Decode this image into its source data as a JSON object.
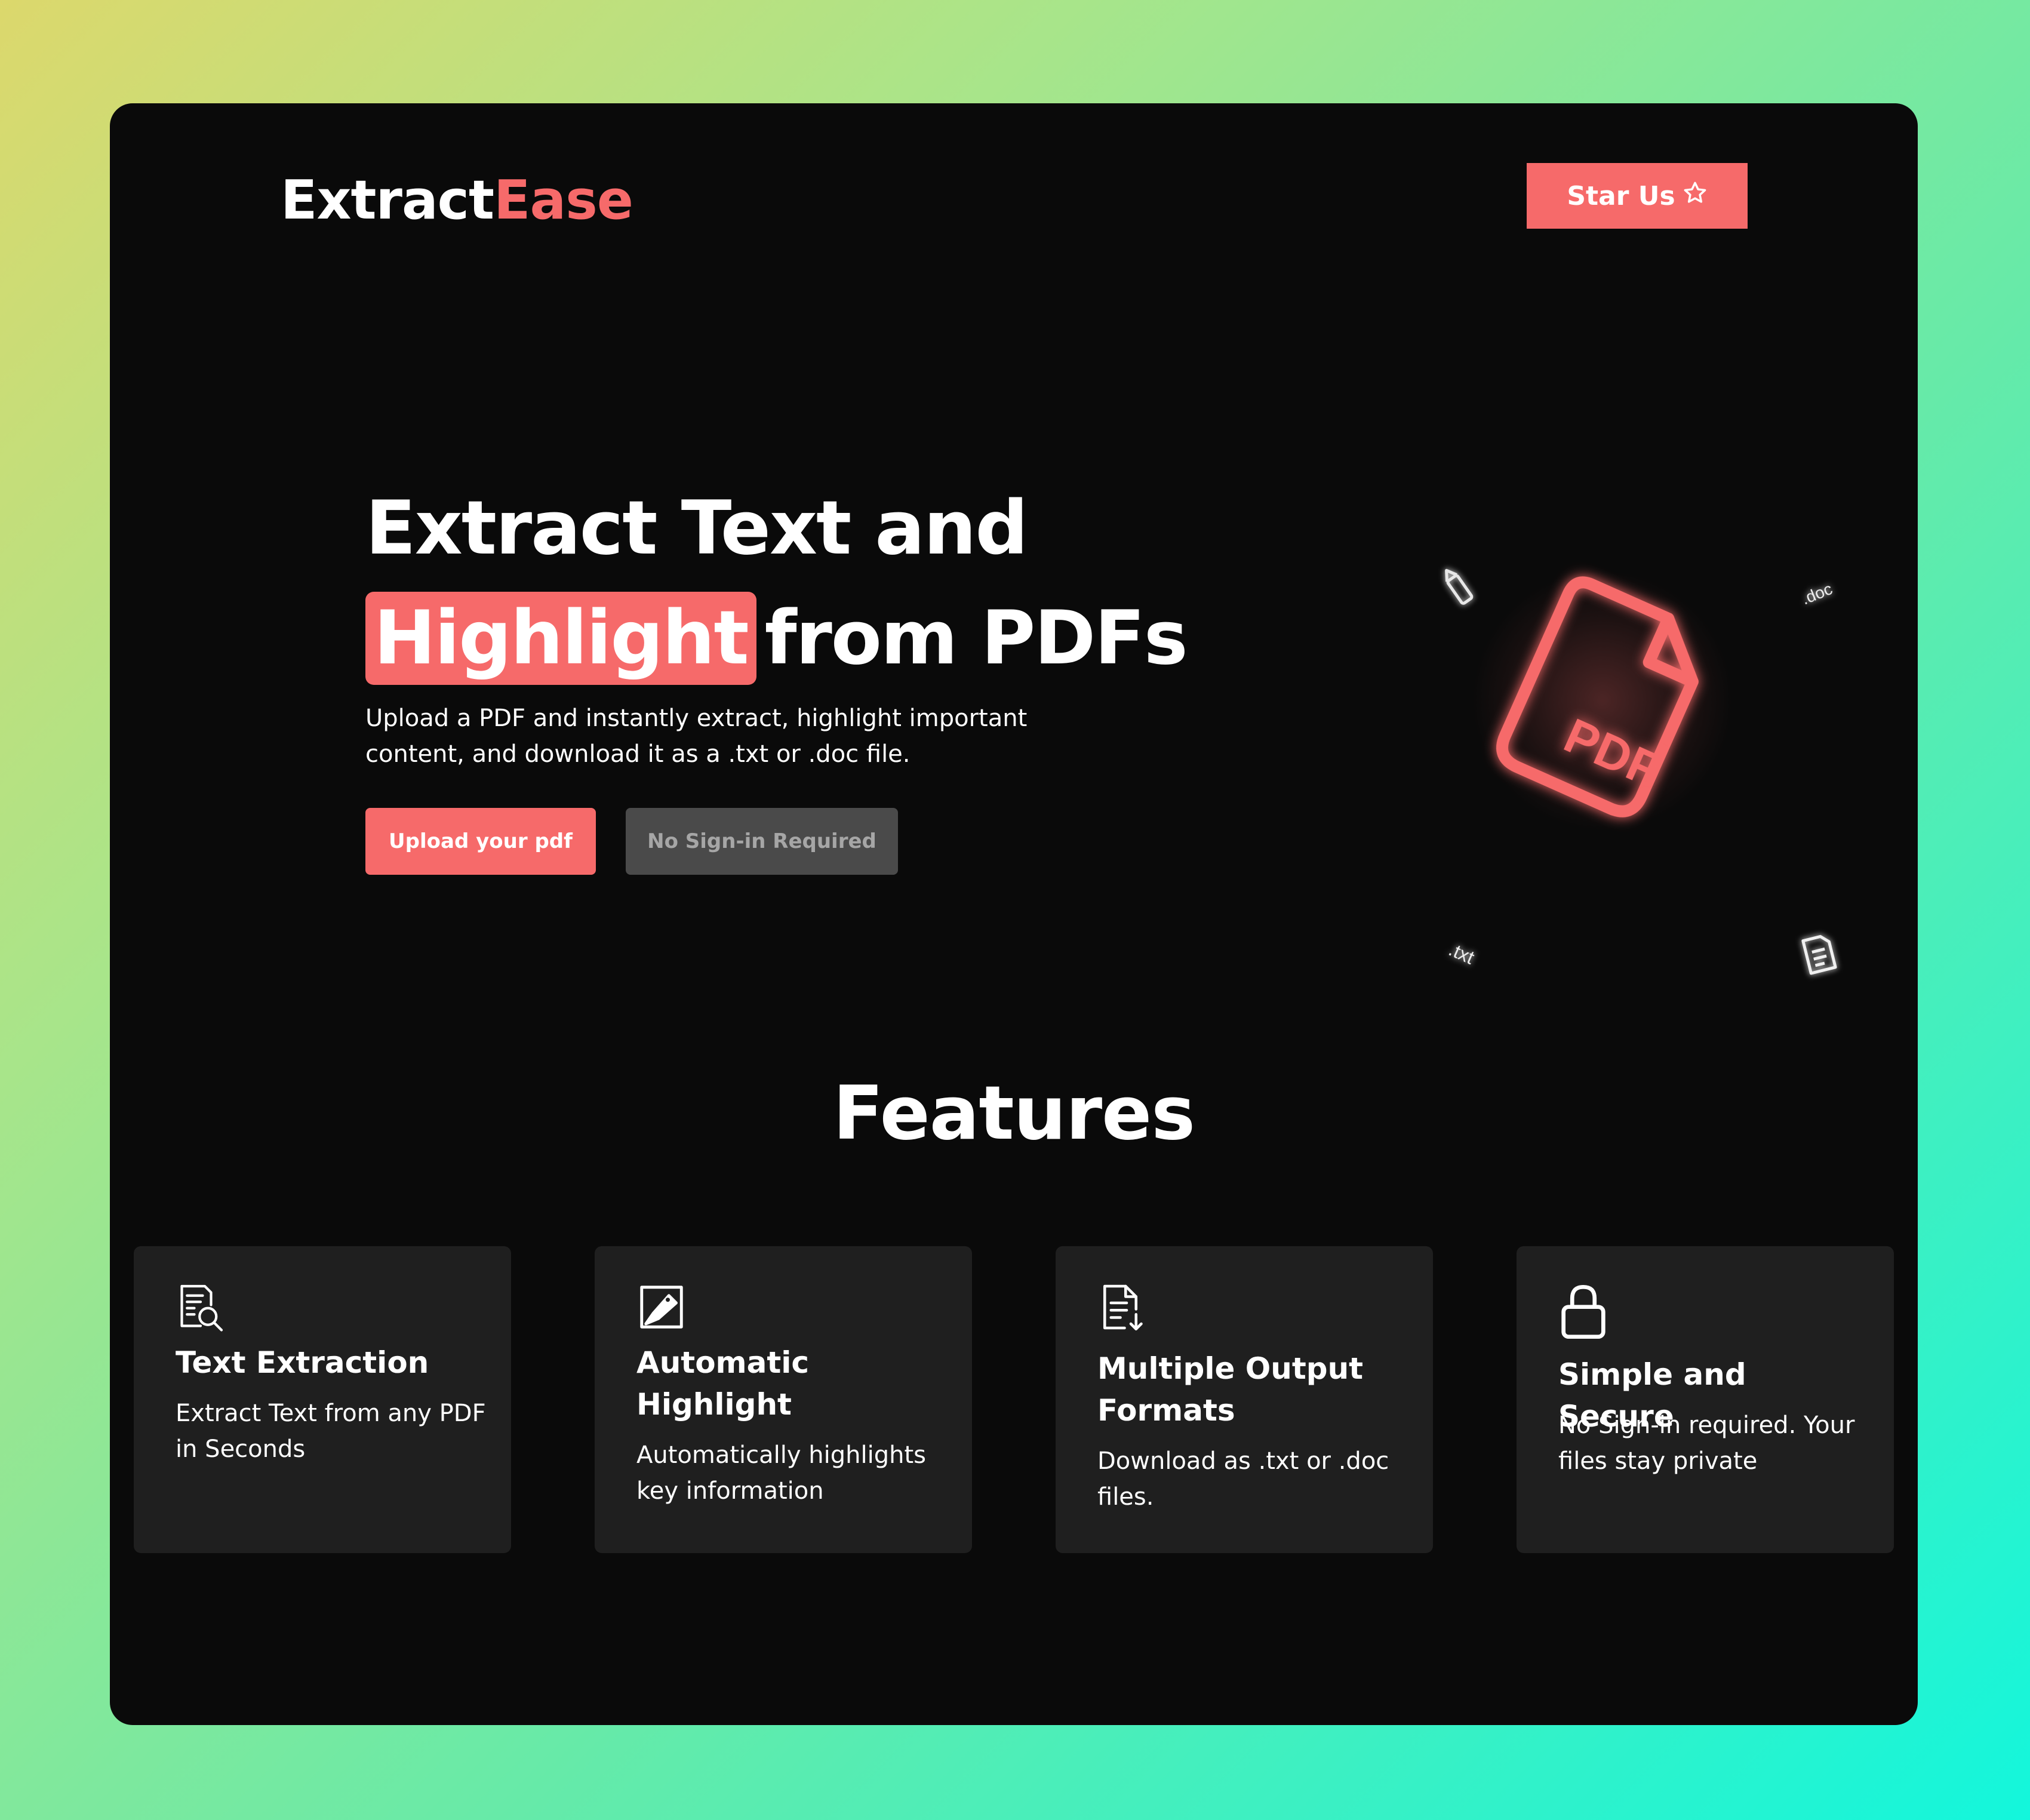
{
  "brand": {
    "part1": "Extract",
    "part2": "Ease"
  },
  "header": {
    "star_label": "Star Us"
  },
  "hero": {
    "title_line1": "Extract Text and",
    "title_highlight": "Highlight",
    "title_rest": "from PDFs",
    "subtitle": "Upload a PDF and instantly extract, highlight important content, and download it as a .txt or .doc file.",
    "upload_label": "Upload your pdf",
    "no_signin_label": "No Sign-in Required"
  },
  "illustration": {
    "pdf_label": "PDF",
    "doc_tag": ".doc",
    "txt_tag": ".txt"
  },
  "features": {
    "title": "Features",
    "cards": [
      {
        "icon": "document-search-icon",
        "title": "Text Extraction",
        "desc": "Extract Text from any PDF in Seconds"
      },
      {
        "icon": "highlighter-icon",
        "title": "Automatic Highlight",
        "desc": "Automatically highlights key information"
      },
      {
        "icon": "document-download-icon",
        "title": "Multiple Output Formats",
        "desc": "Download as .txt or .doc files."
      },
      {
        "icon": "lock-icon",
        "title": "Simple and Secure",
        "desc": "No Sign-in required. Your files stay private"
      }
    ]
  },
  "colors": {
    "accent": "#f66a6a",
    "background": "#0a0a0a",
    "card": "#1f1f1f",
    "muted_button": "#4a4a4a"
  }
}
